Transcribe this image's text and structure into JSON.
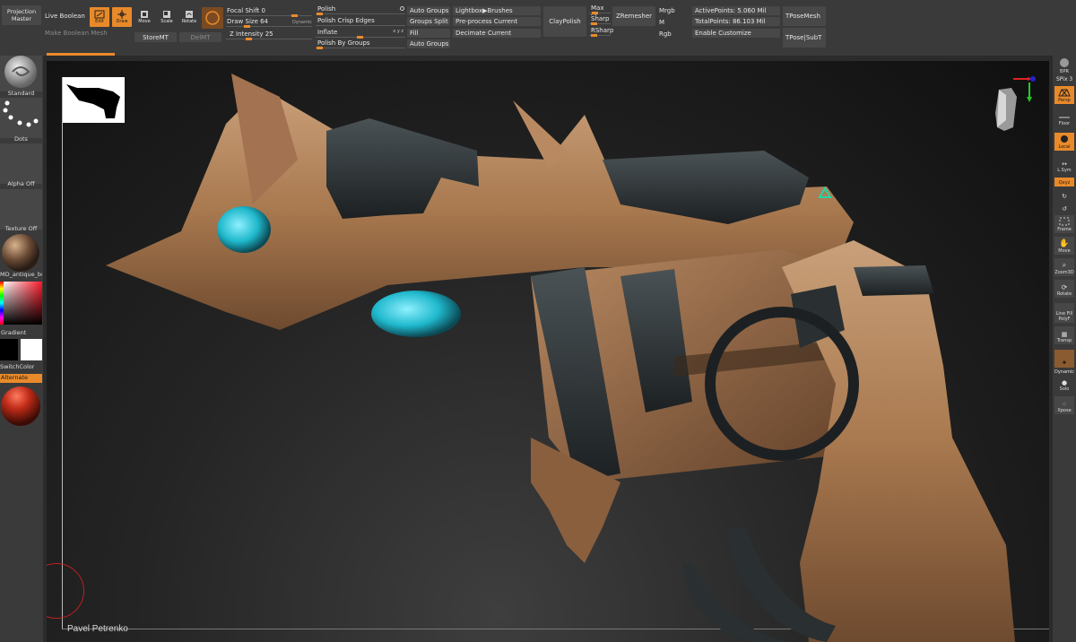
{
  "toolbar": {
    "projection_master": "Projection\nMaster",
    "live_boolean": "Live Boolean",
    "make_boolean_mesh": "Make Boolean Mesh",
    "edit": "Edit",
    "draw": "Draw",
    "move": "Move",
    "scale": "Scale",
    "rotate": "Rotate",
    "store_mt": "StoreMT",
    "del_mt": "DelMT",
    "focal_shift": "Focal Shift 0",
    "draw_size": "Draw Size 64",
    "dynamic": "Dynamic",
    "z_intensity": "Z Intensity 25",
    "polish": "Polish",
    "polish_crisp_edges": "Polish Crisp Edges",
    "inflate": "Inflate",
    "polish_by_groups": "Polish By Groups",
    "auto_groups": "Auto Groups",
    "groups_split": "Groups Split",
    "fill": "Fill",
    "auto_groups_2": "Auto Groups",
    "lightbox_brushes": "Lightbox▶Brushes",
    "preprocess_current": "Pre-process Current",
    "decimate_current": "Decimate Current",
    "claypolish": "ClayPolish",
    "max": "Max 25",
    "sharp": "Sharp",
    "rsharp": "RSharp",
    "zremesher": "ZRemesher",
    "mrgb": "Mrgb",
    "m": "M",
    "rgb": "Rgb",
    "active_points": "ActivePoints: 5.060 Mil",
    "total_points": "TotalPoints: 86.103 Mil",
    "enable_customize": "Enable Customize",
    "tpose_mesh": "TPoseMesh",
    "tpose_subt": "TPose|SubT"
  },
  "left_panel": {
    "standard": "Standard",
    "dots": "Dots",
    "alpha_off": "Alpha Off",
    "texture_off": "Texture Off",
    "material": "MD_antique_bro",
    "gradient": "Gradient",
    "switch_color": "SwitchColor",
    "alternate": "Alternate"
  },
  "right_shelf": {
    "bpr": "BPR",
    "spix": "SPix 3",
    "persp": "Persp",
    "floor": "Floor",
    "local": "Local",
    "lsym": "L.Sym",
    "xyz": "Qxyz",
    "frame": "Frame",
    "move": "Move",
    "zoom3d": "Zoom3D",
    "rotate": "Rotate",
    "line_fill": "Line Fill",
    "polyf": "PolyF",
    "transp": "Transp",
    "dynamic": "Dynamic",
    "solo": "Solo",
    "xpose": "Xpose"
  },
  "viewport": {
    "credit": "Pavel Petrenko"
  },
  "colors": {
    "accent": "#e98a2a",
    "panel": "#3a3a3a",
    "button": "#484848",
    "mesh_tan": "#b98a62",
    "mesh_dark": "#2f3436",
    "gem": "#1fb8cc"
  }
}
